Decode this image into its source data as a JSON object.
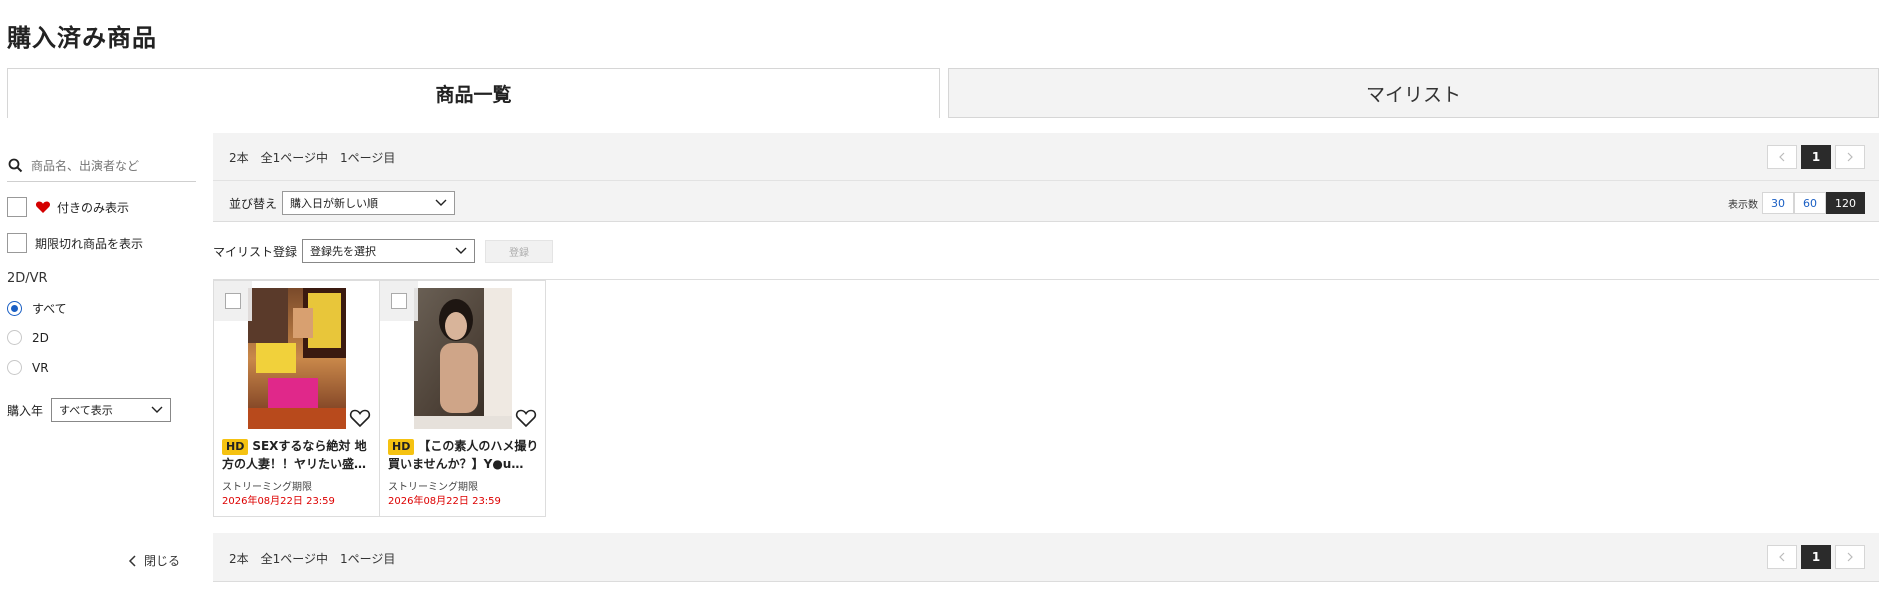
{
  "page": {
    "title": "購入済み商品"
  },
  "tabs": [
    {
      "label": "商品一覧",
      "active": true
    },
    {
      "label": "マイリスト",
      "active": false
    }
  ],
  "sidebar": {
    "search_placeholder": "商品名、出演者など",
    "fav_only_label": "付きのみ表示",
    "show_expired_label": "期限切れ商品を表示",
    "dim_label": "2D/VR",
    "dim_options": [
      {
        "label": "すべて",
        "selected": true
      },
      {
        "label": "2D",
        "selected": false
      },
      {
        "label": "VR",
        "selected": false
      }
    ],
    "year_label": "購入年",
    "year_value": "すべて表示",
    "close_label": "閉じる"
  },
  "results": {
    "summary": "2本　全1ページ中　1ページ目",
    "current_page": "1",
    "sort_label": "並び替え",
    "sort_value": "購入日が新しい順",
    "per_page_label": "表示数",
    "per_page_options": [
      "30",
      "60",
      "120"
    ],
    "per_page_selected": "120"
  },
  "mylist": {
    "label": "マイリスト登録",
    "select_value": "登録先を選択",
    "button_label": "登録"
  },
  "items": [
    {
      "badge": "HD",
      "title": "SEXするなら絶対 地方の人妻！！ヤリたい盛…",
      "expiry_label": "ストリーミング期限",
      "expiry_date": "2026年08月22日 23:59"
    },
    {
      "badge": "HD",
      "title": "【この素人のハメ撮り買いませんか？】Y●u…",
      "expiry_label": "ストリーミング期限",
      "expiry_date": "2026年08月22日 23:59"
    }
  ],
  "colors": {
    "accent_blue": "#1a5fc4",
    "expiry_red": "#dd0000",
    "hd_yellow": "#f5c211",
    "bar_gray": "#f3f3f3"
  }
}
